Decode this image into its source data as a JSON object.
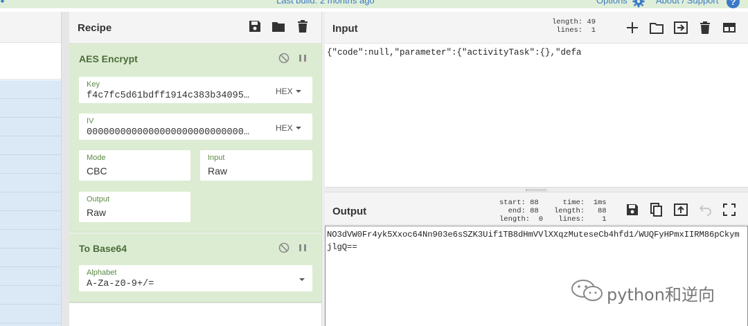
{
  "topbar": {
    "build_text": "Last build: 2 months ago",
    "options_label": "Options",
    "about_label": "About / Support",
    "help_label": "?"
  },
  "recipe": {
    "title": "Recipe",
    "operations": [
      {
        "name": "AES Encrypt",
        "key_label": "Key",
        "key_value": "f4c7fc5d61bdff1914c383b34095…",
        "key_format": "HEX",
        "iv_label": "IV",
        "iv_value": "0000000000000000000000000000…",
        "iv_format": "HEX",
        "mode_label": "Mode",
        "mode_value": "CBC",
        "input_label": "Input",
        "input_value": "Raw",
        "output_label": "Output",
        "output_value": "Raw"
      },
      {
        "name": "To Base64",
        "alphabet_label": "Alphabet",
        "alphabet_value": "A-Za-z0-9+/="
      }
    ]
  },
  "input": {
    "title": "Input",
    "stats": "length: 49\n lines:  1",
    "text": "{\"code\":null,\"parameter\":{\"activityTask\":{},\"defa"
  },
  "output": {
    "title": "Output",
    "stats_a": "start: 88\n  end: 88\nlength:  0",
    "stats_b": "  time:  1ms\nlength:   88\n lines:    1",
    "line1": "NO3dVW0Fr4yk5Xxoc64Nn903e6sSZK3Uif1TB8dHmVVlXXqzMuteseCb4hfd1/WUQFyHPmxIIRM86pCkym",
    "line2": "jlgQ=="
  },
  "watermark": {
    "text": "python和逆向"
  },
  "colors": {
    "accent": "#3b79c6",
    "op_bg": "#dcecd2",
    "op_text": "#4b6c3a",
    "ops_list_bg": "#dbe8f6"
  }
}
